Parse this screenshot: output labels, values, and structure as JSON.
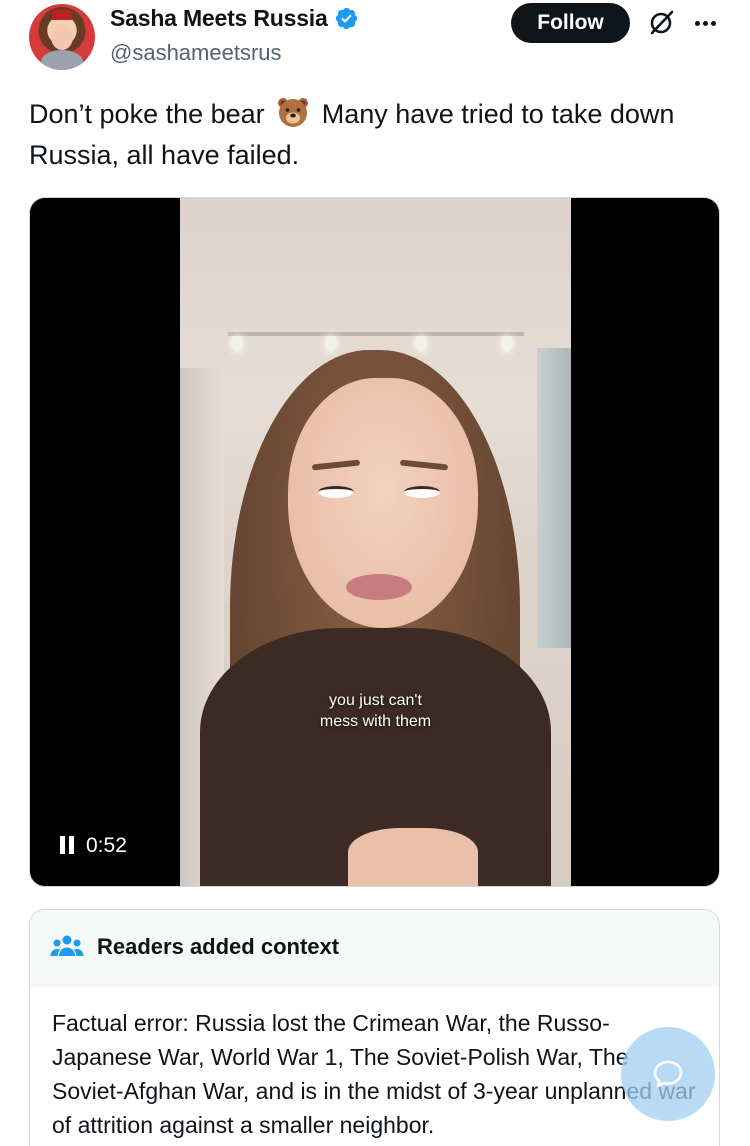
{
  "post": {
    "author": {
      "display_name": "Sasha Meets Russia",
      "handle": "@sashameetsrus",
      "verified": true
    },
    "follow_label": "Follow",
    "text_before_emoji": "Don’t poke the bear",
    "emoji": "bear-face",
    "text_after_emoji": "Many have tried to take down Russia, all have failed."
  },
  "video": {
    "caption_line1": "you just can't",
    "caption_line2": "mess with them",
    "duration": "0:52",
    "state": "playing"
  },
  "community_note": {
    "title": "Readers added context",
    "body": "Factual error: Russia lost the Crimean War, the Russo-Japanese War, World War 1, The Soviet-Polish War, The Soviet-Afghan War, and is in the midst of 3-year unplanned war of attrition against a smaller neighbor."
  },
  "colors": {
    "accent": "#1d9bf0",
    "text": "#0f1419",
    "secondary": "#536471",
    "follow_bg": "#0f1419"
  },
  "icons": [
    "verified-badge-icon",
    "grok-icon",
    "more-icon",
    "bear-face-icon",
    "pause-icon",
    "people-icon",
    "chat-bubble-icon"
  ]
}
